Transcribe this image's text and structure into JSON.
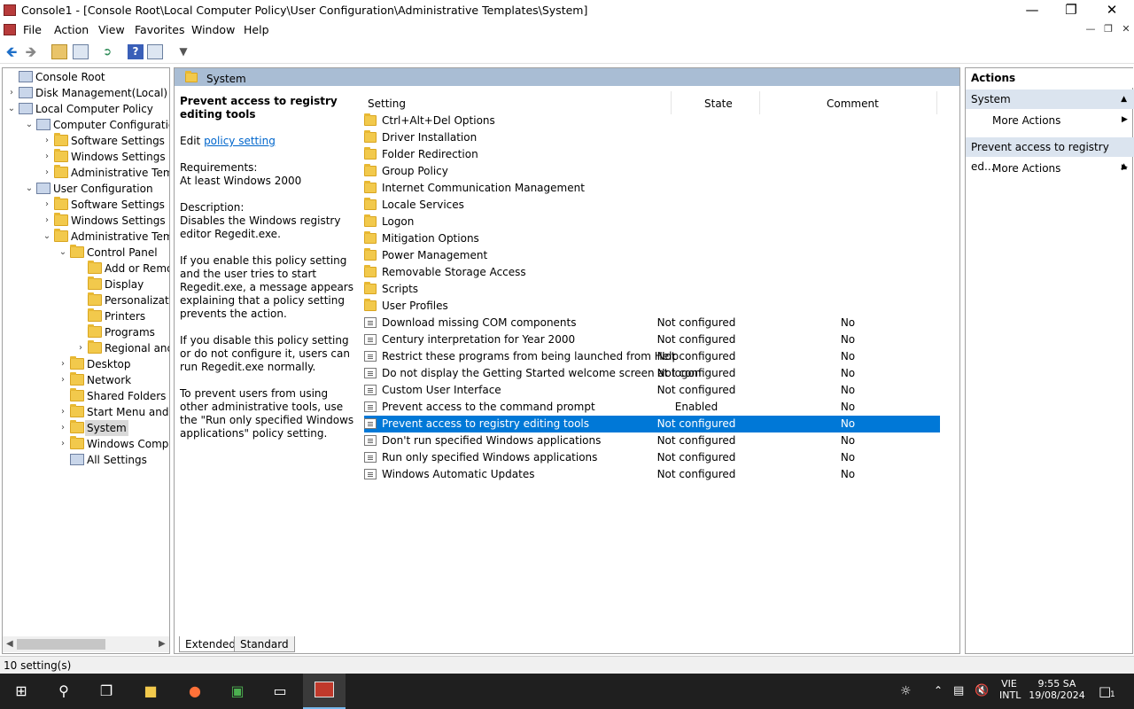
{
  "window": {
    "title": "Console1 - [Console Root\\Local Computer Policy\\User Configuration\\Administrative Templates\\System]"
  },
  "menu": [
    "File",
    "Action",
    "View",
    "Favorites",
    "Window",
    "Help"
  ],
  "tree": [
    {
      "label": "Console Root",
      "icon": "console-icon",
      "arrow": ""
    },
    {
      "label": "Disk Management(Local)",
      "icon": "disk-icon",
      "arrow": "›"
    },
    {
      "label": "Local Computer Policy",
      "icon": "policy-icon",
      "arrow": "⌄"
    },
    {
      "label": "Computer Configuration",
      "icon": "computer-icon",
      "arrow": "⌄"
    },
    {
      "label": "Software Settings",
      "icon": "folder-icon",
      "arrow": "›"
    },
    {
      "label": "Windows Settings",
      "icon": "folder-icon",
      "arrow": "›"
    },
    {
      "label": "Administrative Templates",
      "icon": "folder-icon",
      "arrow": "›"
    },
    {
      "label": "User Configuration",
      "icon": "user-icon",
      "arrow": "⌄"
    },
    {
      "label": "Software Settings",
      "icon": "folder-icon",
      "arrow": "›"
    },
    {
      "label": "Windows Settings",
      "icon": "folder-icon",
      "arrow": "›"
    },
    {
      "label": "Administrative Templates",
      "icon": "folder-icon",
      "arrow": "⌄"
    },
    {
      "label": "Control Panel",
      "icon": "folder-icon",
      "arrow": "⌄"
    },
    {
      "label": "Add or Remove Programs",
      "icon": "folder-icon",
      "arrow": ""
    },
    {
      "label": "Display",
      "icon": "folder-icon",
      "arrow": ""
    },
    {
      "label": "Personalization",
      "icon": "folder-icon",
      "arrow": ""
    },
    {
      "label": "Printers",
      "icon": "folder-icon",
      "arrow": ""
    },
    {
      "label": "Programs",
      "icon": "folder-icon",
      "arrow": ""
    },
    {
      "label": "Regional and Language Options",
      "icon": "folder-icon",
      "arrow": "›"
    },
    {
      "label": "Desktop",
      "icon": "folder-icon",
      "arrow": "›"
    },
    {
      "label": "Network",
      "icon": "folder-icon",
      "arrow": "›"
    },
    {
      "label": "Shared Folders",
      "icon": "folder-icon",
      "arrow": ""
    },
    {
      "label": "Start Menu and Taskbar",
      "icon": "folder-icon",
      "arrow": "›"
    },
    {
      "label": "System",
      "icon": "folder-icon",
      "arrow": "›",
      "selected": true
    },
    {
      "label": "Windows Components",
      "icon": "folder-icon",
      "arrow": "›"
    },
    {
      "label": "All Settings",
      "icon": "settings-icon",
      "arrow": ""
    }
  ],
  "center": {
    "header": "System",
    "desc_title": "Prevent access to registry editing tools",
    "edit_prefix": "Edit ",
    "edit_link": "policy setting",
    "requirements_label": "Requirements:",
    "requirements": "At least Windows 2000",
    "description_label": "Description:",
    "description": "Disables the Windows registry editor Regedit.exe.",
    "para1": "If you enable this policy setting and the user tries to start Regedit.exe, a message appears explaining that a policy setting prevents the action.",
    "para2": "If you disable this policy setting or do not configure it, users can run Regedit.exe normally.",
    "para3": "To prevent users from using other administrative tools, use the \"Run only specified Windows applications\" policy setting.",
    "col_setting": "Setting",
    "col_state": "State",
    "col_comment": "Comment",
    "rows": [
      {
        "name": "Ctrl+Alt+Del Options",
        "state": "",
        "comment": "",
        "type": "folder"
      },
      {
        "name": "Driver Installation",
        "state": "",
        "comment": "",
        "type": "folder"
      },
      {
        "name": "Folder Redirection",
        "state": "",
        "comment": "",
        "type": "folder"
      },
      {
        "name": "Group Policy",
        "state": "",
        "comment": "",
        "type": "folder"
      },
      {
        "name": "Internet Communication Management",
        "state": "",
        "comment": "",
        "type": "folder"
      },
      {
        "name": "Locale Services",
        "state": "",
        "comment": "",
        "type": "folder"
      },
      {
        "name": "Logon",
        "state": "",
        "comment": "",
        "type": "folder"
      },
      {
        "name": "Mitigation Options",
        "state": "",
        "comment": "",
        "type": "folder"
      },
      {
        "name": "Power Management",
        "state": "",
        "comment": "",
        "type": "folder"
      },
      {
        "name": "Removable Storage Access",
        "state": "",
        "comment": "",
        "type": "folder"
      },
      {
        "name": "Scripts",
        "state": "",
        "comment": "",
        "type": "folder"
      },
      {
        "name": "User Profiles",
        "state": "",
        "comment": "",
        "type": "folder"
      },
      {
        "name": "Download missing COM components",
        "state": "Not configured",
        "comment": "No",
        "type": "policy"
      },
      {
        "name": "Century interpretation for Year 2000",
        "state": "Not configured",
        "comment": "No",
        "type": "policy"
      },
      {
        "name": "Restrict these programs from being launched from Help",
        "state": "Not configured",
        "comment": "No",
        "type": "policy"
      },
      {
        "name": "Do not display the Getting Started welcome screen at logon",
        "state": "Not configured",
        "comment": "No",
        "type": "policy"
      },
      {
        "name": "Custom User Interface",
        "state": "Not configured",
        "comment": "No",
        "type": "policy"
      },
      {
        "name": "Prevent access to the command prompt",
        "state": "Enabled",
        "comment": "No",
        "type": "policy"
      },
      {
        "name": "Prevent access to registry editing tools",
        "state": "Not configured",
        "comment": "No",
        "type": "policy",
        "selected": true
      },
      {
        "name": "Don't run specified Windows applications",
        "state": "Not configured",
        "comment": "No",
        "type": "policy"
      },
      {
        "name": "Run only specified Windows applications",
        "state": "Not configured",
        "comment": "No",
        "type": "policy"
      },
      {
        "name": "Windows Automatic Updates",
        "state": "Not configured",
        "comment": "No",
        "type": "policy"
      }
    ],
    "tab_extended": "Extended",
    "tab_standard": "Standard"
  },
  "actions": {
    "title": "Actions",
    "group1": "System",
    "more1": "More Actions",
    "group2": "Prevent access to registry ed...",
    "more2": "More Actions"
  },
  "status": "10 setting(s)",
  "taskbar": {
    "lang1": "VIE",
    "lang2": "INTL",
    "time": "9:55 SA",
    "date": "19/08/2024",
    "notif_count": "1"
  },
  "colors": {
    "selection": "#0078d7",
    "header_band": "#a9bdd4",
    "taskbar": "#1f1f1f"
  }
}
